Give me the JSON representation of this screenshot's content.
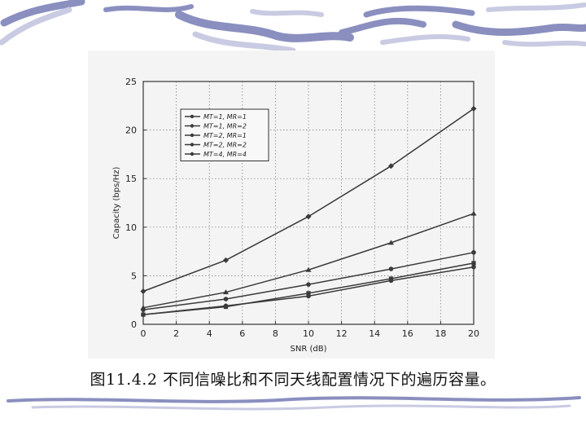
{
  "slide": {
    "caption": "图11.4.2  不同信噪比和不同天线配置情况下的遍历容量。",
    "colors": {
      "background": "#ffffff",
      "wave": "#8a8fbf",
      "wave_light": "#c9cbe3",
      "line": "#3a3a3a"
    }
  },
  "chart_data": {
    "type": "line",
    "title": "",
    "xlabel": "SNR (dB)",
    "ylabel": "Capacity (bps/Hz)",
    "xlim": [
      0,
      20
    ],
    "ylim": [
      0,
      25
    ],
    "xticks": [
      0,
      2,
      4,
      6,
      8,
      10,
      12,
      14,
      16,
      18,
      20
    ],
    "yticks": [
      0,
      5,
      10,
      15,
      20,
      25
    ],
    "grid": true,
    "legend_position": "top-left",
    "x": [
      0,
      5,
      10,
      15,
      20
    ],
    "series": [
      {
        "name": "MT=1, MR=1",
        "values": [
          1.0,
          1.9,
          2.9,
          4.5,
          5.9
        ]
      },
      {
        "name": "MT=1, MR=2",
        "values": [
          1.5,
          2.6,
          4.1,
          5.7,
          7.4
        ]
      },
      {
        "name": "MT=2, MR=1",
        "values": [
          1.0,
          1.8,
          3.2,
          4.7,
          6.3
        ]
      },
      {
        "name": "MT=2, MR=2",
        "values": [
          1.7,
          3.3,
          5.6,
          8.4,
          11.4
        ]
      },
      {
        "name": "MT=4, MR=4",
        "values": [
          3.4,
          6.6,
          11.1,
          16.3,
          22.2
        ]
      }
    ]
  }
}
